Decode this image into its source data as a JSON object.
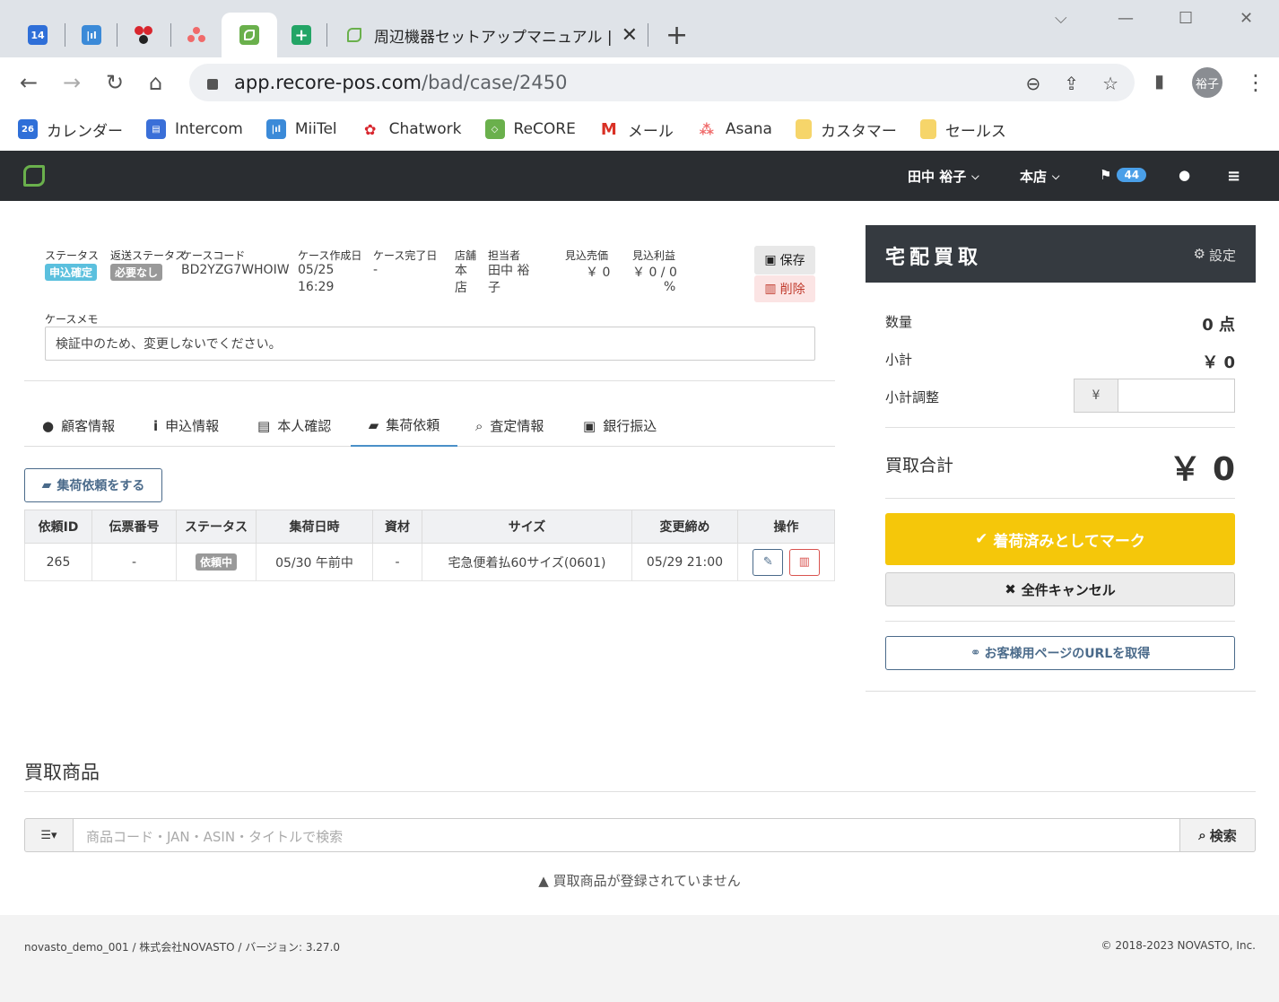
{
  "browser": {
    "active_tab_title": "周辺機器セットアップマニュアル | ユーザ",
    "url_host": "app.recore-pos.com",
    "url_path": "/bad/case/2450",
    "profile": "裕子",
    "tab_icons": [
      "calendar-14-icon",
      "miitel-icon",
      "chatwork-icon",
      "asana-icon",
      "recore-icon",
      "sheets-icon"
    ],
    "calendar_day": "14"
  },
  "bookmarks": [
    {
      "label": "カレンダー",
      "icon": "calendar-icon",
      "badge": "26"
    },
    {
      "label": "Intercom",
      "icon": "intercom-icon"
    },
    {
      "label": "MiiTel",
      "icon": "miitel-icon"
    },
    {
      "label": "Chatwork",
      "icon": "chatwork-icon"
    },
    {
      "label": "ReCORE",
      "icon": "recore-icon"
    },
    {
      "label": "メール",
      "icon": "gmail-icon"
    },
    {
      "label": "Asana",
      "icon": "asana-icon"
    },
    {
      "label": "カスタマー",
      "icon": "folder-icon"
    },
    {
      "label": "セールス",
      "icon": "folder-icon"
    }
  ],
  "appnav": {
    "user": "田中 裕子",
    "store": "本店",
    "flag_count": "44"
  },
  "case": {
    "status_label": "ステータス",
    "status": "申込確定",
    "return_status_label": "返送ステータス",
    "return_status": "必要なし",
    "code_label": "ケースコード",
    "code": "BD2YZG7WHOIW",
    "created_label": "ケース作成日",
    "created_date": "05/25",
    "created_time": "16:29",
    "completed_label": "ケース完了日",
    "completed": "-",
    "store_label": "店舗",
    "store": "本店",
    "staff_label": "担当者",
    "staff": "田中 裕子",
    "est_sales_label": "見込売価",
    "est_sales": "￥ 0",
    "est_profit_label": "見込利益",
    "est_profit": "￥ 0 / 0",
    "est_profit_pct": "%",
    "save": "保存",
    "delete": "削除",
    "memo_label": "ケースメモ",
    "memo": "検証中のため、変更しないでください。"
  },
  "tabs": [
    {
      "label": "顧客情報",
      "icon": "user-icon"
    },
    {
      "label": "申込情報",
      "icon": "info-icon"
    },
    {
      "label": "本人確認",
      "icon": "id-card-icon"
    },
    {
      "label": "集荷依頼",
      "icon": "truck-icon",
      "active": true
    },
    {
      "label": "査定情報",
      "icon": "search-icon"
    },
    {
      "label": "銀行振込",
      "icon": "money-icon"
    }
  ],
  "pickup": {
    "request_button": "集荷依頼をする",
    "columns": [
      "依頼ID",
      "伝票番号",
      "ステータス",
      "集荷日時",
      "資材",
      "サイズ",
      "変更締め",
      "操作"
    ],
    "rows": [
      {
        "id": "265",
        "slip": "-",
        "status": "依頼中",
        "date": "05/30 午前中",
        "material": "-",
        "size": "宅急便着払60サイズ(0601)",
        "deadline": "05/29 21:00"
      }
    ]
  },
  "side": {
    "title": "宅配買取",
    "settings": "設定",
    "qty_label": "数量",
    "qty": "0 点",
    "subtotal_label": "小計",
    "subtotal": "￥ 0",
    "adjust_label": "小計調整",
    "adjust_unit": "¥",
    "total_label": "買取合計",
    "total": "￥ 0",
    "mark_button": "着荷済みとしてマーク",
    "cancel_button": "全件キャンセル",
    "url_button": "お客様用ページのURLを取得"
  },
  "products": {
    "title": "買取商品",
    "search_placeholder": "商品コード・JAN・ASIN・タイトルで検索",
    "search_button": "検索",
    "empty": "買取商品が登録されていません"
  },
  "footer": {
    "left": "novasto_demo_001 / 株式会社NOVASTO / バージョン: 3.27.0",
    "right": "© 2018-2023 NOVASTO, Inc."
  },
  "colors": {
    "nav_bg": "#2a2d31",
    "status_label": "#5bc0de",
    "return_label": "#999999",
    "mark_button": "#f5c70a",
    "tab_active": "#4a90c8"
  }
}
